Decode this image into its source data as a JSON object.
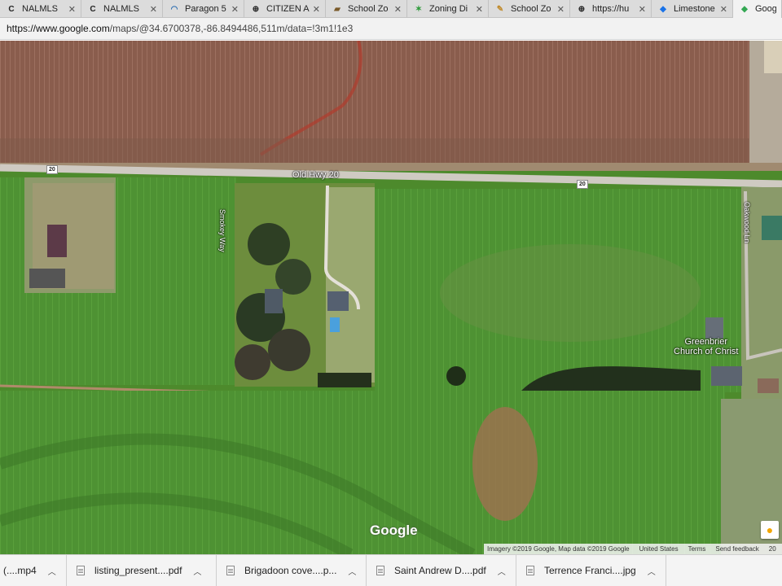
{
  "tabs": [
    {
      "label": "NALMLS",
      "icon": "nalmls-c-icon",
      "glyph": "C",
      "active": false
    },
    {
      "label": "NALMLS",
      "icon": "nalmls-c-icon",
      "glyph": "C",
      "active": false
    },
    {
      "label": "Paragon 5",
      "icon": "paragon-icon",
      "glyph": "◠",
      "active": false
    },
    {
      "label": "CITIZEN A",
      "icon": "globe-icon",
      "glyph": "⊕",
      "active": false
    },
    {
      "label": "School Zo",
      "icon": "school-zone-icon",
      "glyph": "▰",
      "active": false
    },
    {
      "label": "Zoning Di",
      "icon": "zoning-star-icon",
      "glyph": "✶",
      "active": false
    },
    {
      "label": "School Zo",
      "icon": "school-zone-icon",
      "glyph": "✎",
      "active": false
    },
    {
      "label": "https://hu",
      "icon": "globe-icon",
      "glyph": "⊕",
      "active": false
    },
    {
      "label": "Limestone",
      "icon": "limestone-icon",
      "glyph": "◆",
      "active": false
    },
    {
      "label": "Google",
      "icon": "google-maps-icon",
      "glyph": "◆",
      "active": true
    }
  ],
  "address": {
    "host": "https://www.google.com",
    "path": "/maps/@34.6700378,-86.8494486,511m/data=!3m1!1e3"
  },
  "map": {
    "road_label": "Old Hwy 20",
    "shield_left": "20",
    "shield_right": "20",
    "street_smokey": "Smokey Way",
    "street_oakwood": "Oakwood Ln",
    "church_line1": "Greenbrier",
    "church_line2": "Church of Christ",
    "logo": "Google",
    "attribution": {
      "imagery": "Imagery ©2019 Google, Map data ©2019 Google",
      "country": "United States",
      "terms": "Terms",
      "feedback": "Send feedback",
      "scale": "20"
    }
  },
  "downloads": [
    {
      "label": "(....mp4"
    },
    {
      "label": "listing_present....pdf"
    },
    {
      "label": "Brigadoon cove....p..."
    },
    {
      "label": "Saint Andrew D....pdf"
    },
    {
      "label": "Terrence Franci....jpg"
    }
  ],
  "colors": {
    "field_brown": "#8c5e4e",
    "field_green": "#4f9233",
    "road": "#c9c4bd"
  }
}
